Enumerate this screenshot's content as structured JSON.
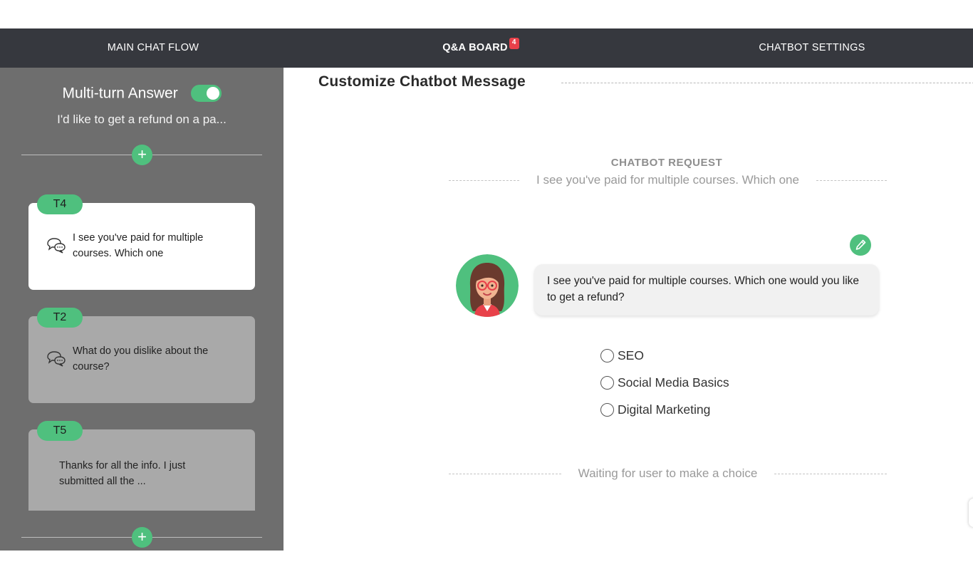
{
  "nav": {
    "tabs": [
      {
        "label": "MAIN CHAT FLOW"
      },
      {
        "label": "Q&A BOARD",
        "badge": "4"
      },
      {
        "label": "CHATBOT SETTINGS"
      }
    ]
  },
  "sidebar": {
    "multi_turn_label": "Multi-turn Answer",
    "multi_turn_enabled": true,
    "question_preview": "I'd like to get a refund on a pa...",
    "cards": [
      {
        "tag": "T4",
        "text": "I see you've paid for multiple courses. Which one",
        "icon": "chat-bubbles-icon",
        "active": true
      },
      {
        "tag": "T2",
        "text": "What do you dislike about the course?",
        "icon": "chat-bubbles-icon",
        "active": false
      },
      {
        "tag": "T5",
        "text": "Thanks for all the info. I just submitted all the ...",
        "icon": null,
        "active": false
      }
    ],
    "add_symbol": "+"
  },
  "main": {
    "section_title": "Customize Chatbot Message",
    "request_label": "CHATBOT REQUEST",
    "request_text": "I see you've paid for multiple courses. Which one",
    "bot_message": "I see you've paid for multiple courses. Which one would you like to get a refund?",
    "options": [
      "SEO",
      "Social Media Basics",
      "Digital Marketing"
    ],
    "waiting_text": "Waiting for user to make a choice"
  },
  "colors": {
    "accent_green": "#4fc07e",
    "nav_bg": "#36383e",
    "sidebar_bg": "#6e6e6e",
    "badge_red": "#e8414a"
  }
}
